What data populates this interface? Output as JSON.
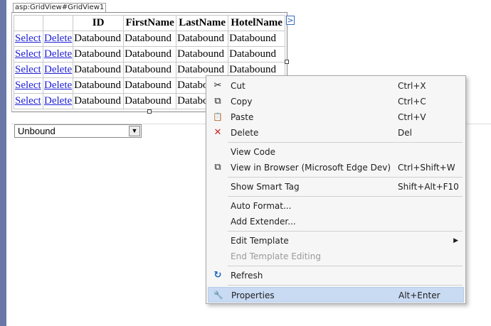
{
  "gridview": {
    "tag_label": "asp:GridView#GridView1",
    "headers": [
      "",
      "",
      "ID",
      "FirstName",
      "LastName",
      "HotelName"
    ],
    "rows": [
      [
        "Select",
        "Delete",
        "Databound",
        "Databound",
        "Databound",
        "Databound"
      ],
      [
        "Select",
        "Delete",
        "Databound",
        "Databound",
        "Databound",
        "Databound"
      ],
      [
        "Select",
        "Delete",
        "Databound",
        "Databound",
        "Databound",
        "Databound"
      ],
      [
        "Select",
        "Delete",
        "Databound",
        "Databound",
        "Databou",
        ""
      ],
      [
        "Select",
        "Delete",
        "Databound",
        "Databound",
        "Databou",
        ""
      ]
    ],
    "smart_tag_glyph": ">"
  },
  "dropdown": {
    "value": "Unbound",
    "arrow": "▼"
  },
  "context_menu": {
    "items": [
      {
        "icon": "scissors-icon",
        "glyph": "✂",
        "label": "Cut",
        "shortcut": "Ctrl+X"
      },
      {
        "icon": "copy-icon",
        "glyph": "⧉",
        "label": "Copy",
        "shortcut": "Ctrl+C"
      },
      {
        "icon": "paste-icon",
        "glyph": "📋",
        "label": "Paste",
        "shortcut": "Ctrl+V"
      },
      {
        "icon": "delete-icon",
        "glyph": "✕",
        "label": "Delete",
        "shortcut": "Del"
      },
      {
        "icon": "",
        "glyph": "",
        "label": "View Code",
        "shortcut": ""
      },
      {
        "icon": "browser-icon",
        "glyph": "⧉",
        "label": "View in Browser (Microsoft Edge Dev)",
        "shortcut": "Ctrl+Shift+W"
      },
      {
        "icon": "",
        "glyph": "",
        "label": "Show Smart Tag",
        "shortcut": "Shift+Alt+F10"
      },
      {
        "icon": "",
        "glyph": "",
        "label": "Auto Format...",
        "shortcut": ""
      },
      {
        "icon": "",
        "glyph": "",
        "label": "Add Extender...",
        "shortcut": ""
      },
      {
        "icon": "",
        "glyph": "",
        "label": "Edit Template",
        "shortcut": "",
        "submenu": "▶"
      },
      {
        "icon": "",
        "glyph": "",
        "label": "End Template Editing",
        "shortcut": ""
      },
      {
        "icon": "refresh-icon",
        "glyph": "↻",
        "label": "Refresh",
        "shortcut": ""
      },
      {
        "icon": "wrench-icon",
        "glyph": "🔧",
        "label": "Properties",
        "shortcut": "Alt+Enter"
      }
    ]
  }
}
